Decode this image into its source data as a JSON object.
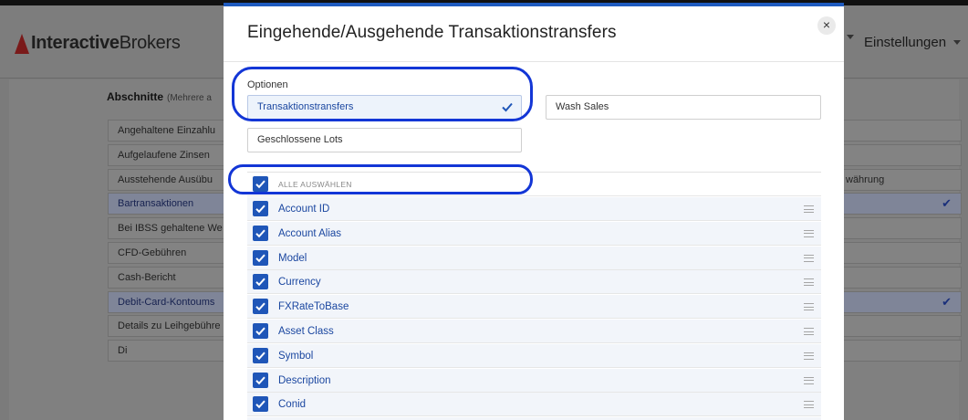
{
  "background": {
    "logo": {
      "brand_bold": "Interactive",
      "brand_light": "Brokers"
    },
    "header_menu": {
      "settings_label": "Einstellungen"
    },
    "sections_title": "Abschnitte",
    "sections_hint": "(Mehrere a",
    "items": [
      {
        "label": "Angehaltene Einzahlu",
        "selected": false
      },
      {
        "label": "Aufgelaufene Zinsen",
        "selected": false
      },
      {
        "label": "Ausstehende Ausübu",
        "selected": false,
        "right_text": "währung"
      },
      {
        "label": "Bartransaktionen",
        "selected": true
      },
      {
        "label": "Bei IBSS gehaltene We",
        "selected": false
      },
      {
        "label": "CFD-Gebühren",
        "selected": false
      },
      {
        "label": "Cash-Bericht",
        "selected": false
      },
      {
        "label": "Debit-Card-Kontoums",
        "selected": true
      },
      {
        "label": "Details zu Leihgebühre",
        "selected": false
      },
      {
        "label": "Di",
        "selected": false
      }
    ]
  },
  "modal": {
    "title": "Eingehende/Ausgehende Transaktionstransfers",
    "close_symbol": "×",
    "options_label": "Optionen",
    "options": [
      {
        "label": "Transaktionstransfers",
        "active": true
      },
      {
        "label": "Wash Sales",
        "active": false
      },
      {
        "label": "Geschlossene Lots",
        "active": false
      }
    ],
    "select_all_label": "ALLE AUSWÄHLEN",
    "fields": [
      "Account ID",
      "Account Alias",
      "Model",
      "Currency",
      "FXRateToBase",
      "Asset Class",
      "Symbol",
      "Description",
      "Conid",
      ""
    ]
  },
  "colors": {
    "accent": "#1f56b8",
    "link_text": "#1b47a0",
    "annotation": "#1336d6",
    "overlay": "#7b7b7b"
  }
}
